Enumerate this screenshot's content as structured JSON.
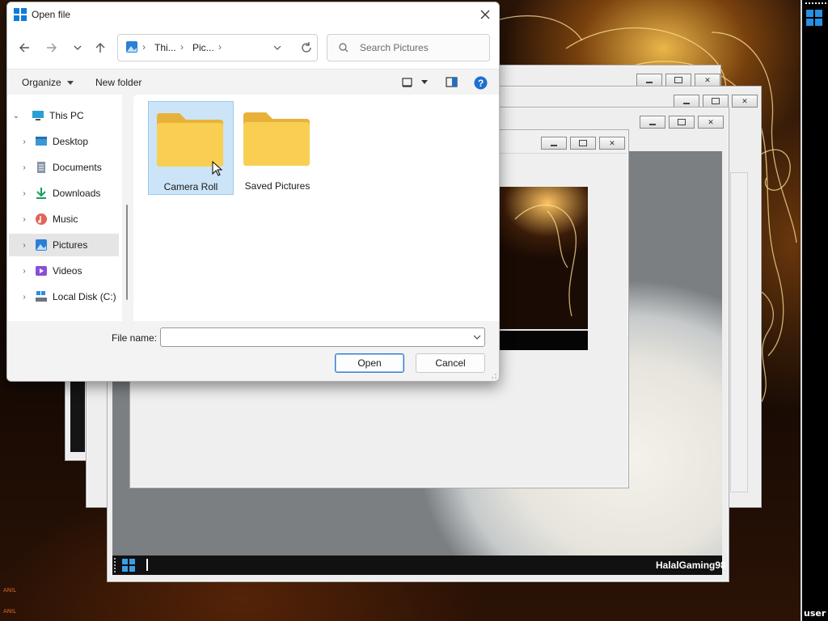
{
  "dialog": {
    "title": "Open file",
    "breadcrumbs": [
      "Thi...",
      "Pic..."
    ],
    "search_placeholder": "Search Pictures",
    "organize_label": "Organize",
    "new_folder_label": "New folder",
    "file_name_label": "File name:",
    "file_name_value": "",
    "open_label": "Open",
    "cancel_label": "Cancel"
  },
  "tree": [
    {
      "label": "This PC",
      "icon": "computer-icon",
      "expanded": true
    },
    {
      "label": "Desktop",
      "icon": "desktop-icon"
    },
    {
      "label": "Documents",
      "icon": "documents-icon"
    },
    {
      "label": "Downloads",
      "icon": "downloads-icon"
    },
    {
      "label": "Music",
      "icon": "music-icon"
    },
    {
      "label": "Pictures",
      "icon": "pictures-icon",
      "selected": true
    },
    {
      "label": "Videos",
      "icon": "videos-icon"
    },
    {
      "label": "Local Disk (C:)",
      "icon": "drive-icon"
    }
  ],
  "folders": [
    {
      "label": "Camera Roll",
      "selected": true
    },
    {
      "label": "Saved Pictures",
      "selected": false
    }
  ],
  "desktop": {
    "username_banner": "HalalGaming98",
    "sidebar_user": "user"
  },
  "colors": {
    "accent": "#0067c0",
    "folder_yellow": "#f8cf52",
    "selection": "#cce4f7"
  }
}
